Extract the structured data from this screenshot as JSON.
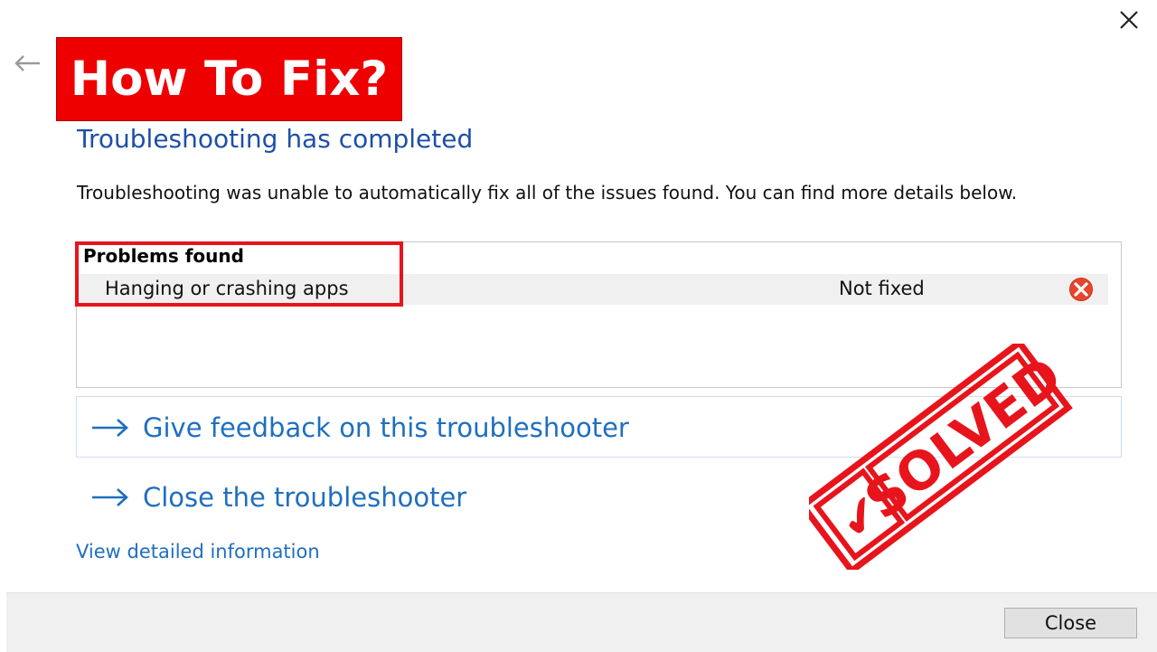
{
  "banner": {
    "text": "How To Fix?"
  },
  "dialog": {
    "heading": "Troubleshooting has completed",
    "description": "Troubleshooting was unable to automatically fix all of the issues found. You can find more details below.",
    "problems": {
      "title": "Problems found",
      "items": [
        {
          "name": "Hanging or crashing apps",
          "status": "Not fixed",
          "status_icon": "error-x-icon"
        }
      ]
    },
    "links": {
      "feedback": "Give feedback on this troubleshooter",
      "close": "Close the troubleshooter",
      "details": "View detailed information"
    },
    "footer": {
      "close_button": "Close"
    }
  },
  "stamp": {
    "text": "SOLVED",
    "mark": "✔"
  },
  "colors": {
    "banner": "#ee0000",
    "heading": "#1e4fa8",
    "link": "#1f6fbf",
    "highlight": "#e8141c",
    "stamp": "#e8141c",
    "error_icon": "#e8452c"
  }
}
